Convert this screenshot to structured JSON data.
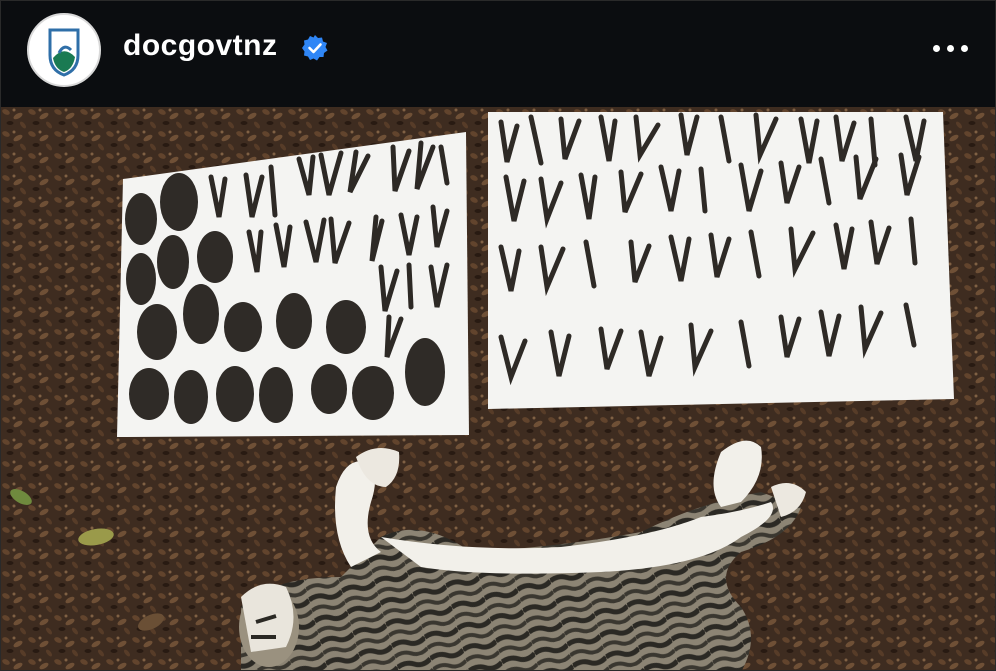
{
  "post": {
    "username": "docgovtnz",
    "verified": true,
    "avatar_icon": "doc-logo-icon",
    "more_icon": "more-options-icon"
  },
  "colors": {
    "header_bg": "#0b0d10",
    "verified_badge": "#2f86f6",
    "logo_green": "#1a7a52",
    "logo_blue": "#2f6fa8"
  }
}
